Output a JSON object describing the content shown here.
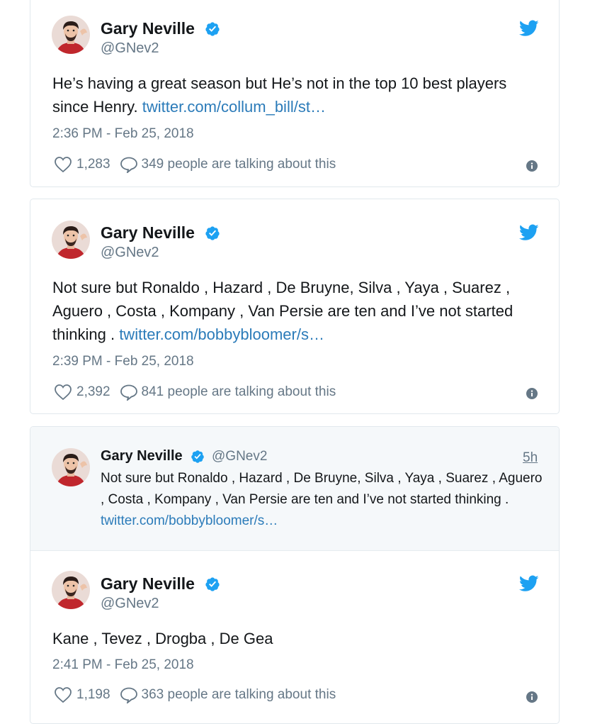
{
  "tweets": [
    {
      "name": "Gary Neville",
      "handle": "@GNev2",
      "text": "He’s having a great season but He’s not in the top 10 best players since Henry.",
      "link": "twitter.com/collum_bill/st…",
      "time": "2:36 PM - Feb 25, 2018",
      "likes": "1,283",
      "talking": "349 people are talking about this"
    },
    {
      "name": "Gary Neville",
      "handle": "@GNev2",
      "text": "Not sure but Ronaldo , Hazard , De Bruyne, Silva , Yaya , Suarez , Aguero , Costa , Kompany , Van Persie are ten and I’ve not started thinking .",
      "link": "twitter.com/bobbybloomer/s…",
      "time": "2:39 PM - Feb 25, 2018",
      "likes": "2,392",
      "talking": "841 people are talking about this"
    }
  ],
  "quoted": {
    "name": "Gary Neville",
    "handle": "@GNev2",
    "age": "5h",
    "text": "Not sure but Ronaldo , Hazard , De Bruyne, Silva , Yaya , Suarez , Aguero , Costa , Kompany , Van Persie are ten and I’ve not started thinking .",
    "link": "twitter.com/bobbybloomer/s…"
  },
  "reply": {
    "name": "Gary Neville",
    "handle": "@GNev2",
    "text": "Kane , Tevez , Drogba , De Gea",
    "time": "2:41 PM - Feb 25, 2018",
    "likes": "1,198",
    "talking": "363 people are talking about this"
  },
  "colors": {
    "twitter_blue": "#1da1f2",
    "link": "#2b7bb9",
    "muted": "#657786",
    "avatar_red": "#c0272d"
  },
  "icons": [
    "avatar",
    "verified-badge-icon",
    "twitter-bird-icon",
    "heart-icon",
    "comment-icon",
    "info-icon"
  ]
}
